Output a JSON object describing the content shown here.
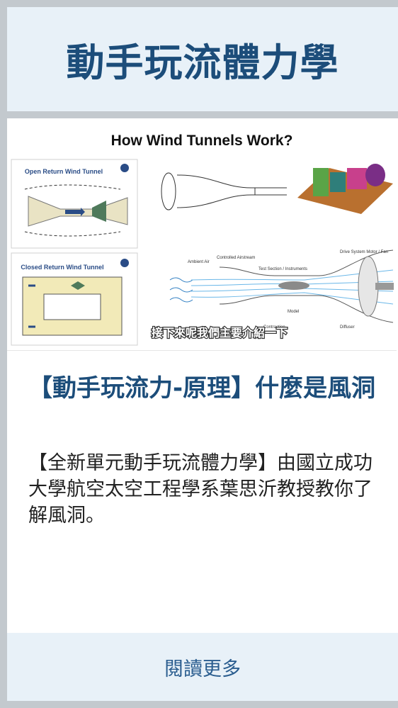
{
  "header": {
    "title": "動手玩流體力學"
  },
  "thumbnail": {
    "heading": "How Wind Tunnels Work?",
    "panel_open_label": "Open Return Wind  Tunnel",
    "panel_closed_label": "Closed Return Wind  Tunnel",
    "subtitle": "接下來呢我們主要介紹一下",
    "label_test_section": "Test Section / Instruments",
    "label_drive_system": "Drive System Motor / Fan",
    "label_contraction": "Contraction",
    "label_diffuser": "Diffuser",
    "label_model": "Model",
    "label_ambient_air": "Ambient Air",
    "label_controlled_airstream": "Controlled Airstream"
  },
  "article": {
    "title": "【動手玩流力-原理】什麼是風洞",
    "description": "【全新單元動手玩流體力學】由國立成功大學航空太空工程學系葉思沂教授教你了解風洞。"
  },
  "footer": {
    "read_more": "閱讀更多"
  }
}
